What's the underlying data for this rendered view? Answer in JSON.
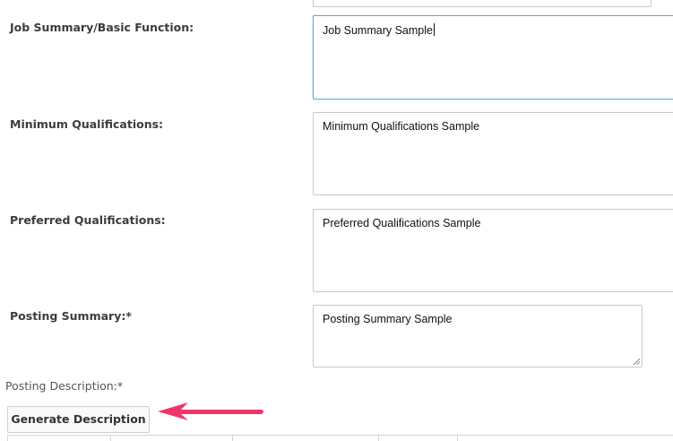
{
  "form": {
    "fields": [
      {
        "label": "Job Summary/Basic Function:",
        "value": "Job Summary Sample"
      },
      {
        "label": "Minimum Qualifications:",
        "value": "Minimum Qualifications Sample"
      },
      {
        "label": "Preferred Qualifications:",
        "value": "Preferred Qualifications Sample"
      },
      {
        "label": "Posting Summary:*",
        "value": "Posting Summary Sample"
      }
    ],
    "posting_description_label": "Posting Description:*",
    "generate_button_label": "Generate Description"
  },
  "icons": {
    "annotation_arrow": "left-arrow-icon",
    "resize_grip": "resize-grip-icon"
  },
  "colors": {
    "focus_border": "#5ab0e0",
    "arrow": "#f0356b",
    "field_border": "#c9c9c9"
  }
}
